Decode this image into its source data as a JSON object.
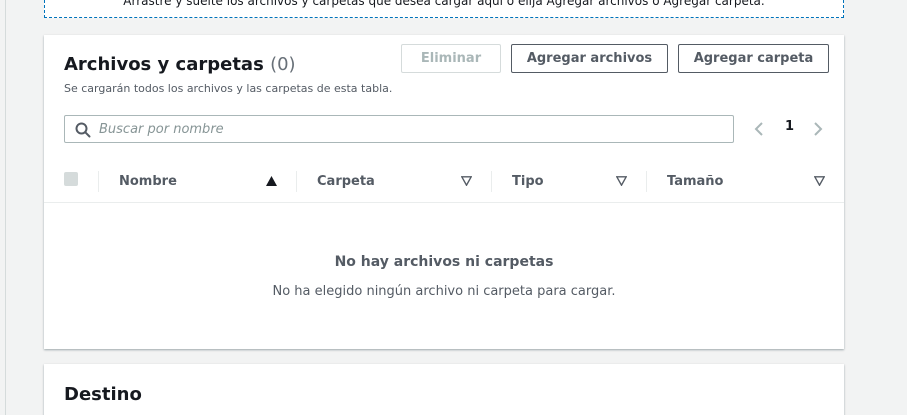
{
  "dropzone": {
    "text": "Arrastre y suelte los archivos y carpetas que desea cargar aquí o elija Agregar archivos o Agregar carpeta."
  },
  "files_panel": {
    "title": "Archivos y carpetas",
    "count": "(0)",
    "description": "Se cargarán todos los archivos y las carpetas de esta tabla.",
    "buttons": {
      "remove": "Eliminar",
      "add_files": "Agregar archivos",
      "add_folder": "Agregar carpeta"
    },
    "search": {
      "placeholder": "Buscar por nombre"
    },
    "pagination": {
      "current_page": "1"
    },
    "columns": [
      "Nombre",
      "Carpeta",
      "Tipo",
      "Tamaño"
    ],
    "empty_state": {
      "title": "No hay archivos ni carpetas",
      "description": "No ha elegido ningún archivo ni carpeta para cargar."
    }
  },
  "destination_panel": {
    "title": "Destino"
  },
  "icons": {
    "search": "search-icon",
    "prev": "chevron-left-icon",
    "next": "chevron-right-icon",
    "sort_asc": "sort-ascending-icon",
    "sort": "sort-descending-icon"
  },
  "colors": {
    "accent": "#0073bb",
    "border": "#545b64",
    "disabled": "#aab7b8"
  }
}
